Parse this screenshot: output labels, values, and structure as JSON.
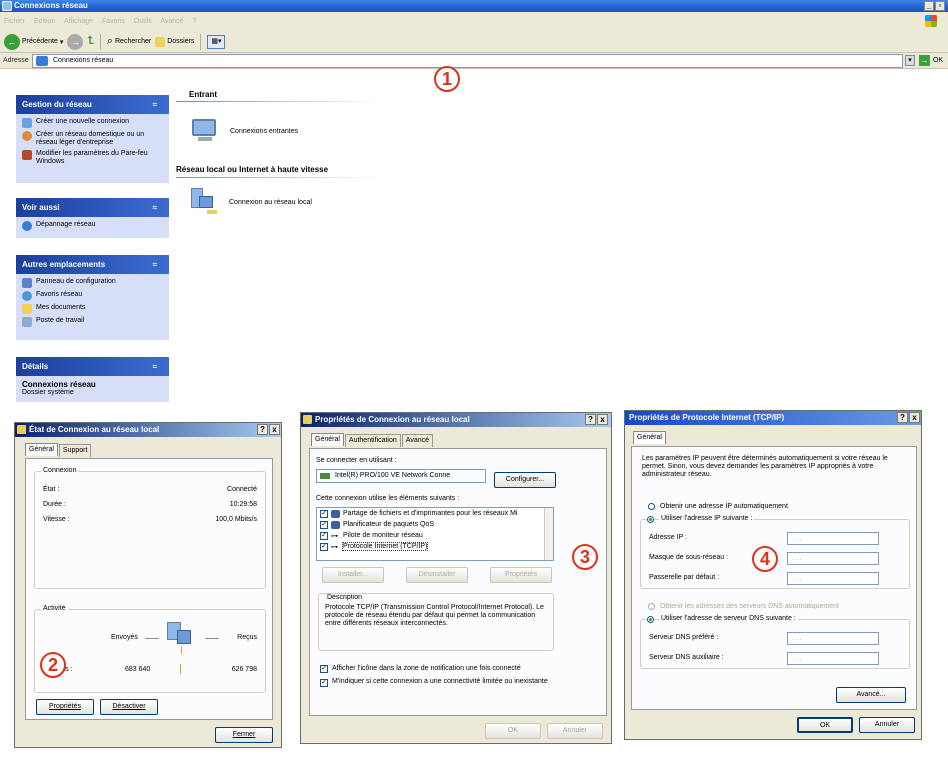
{
  "explorer": {
    "title": "Connexions réseau",
    "menu": [
      "Fichier",
      "Edition",
      "Affichage",
      "Favoris",
      "Outils",
      "Avancé",
      "?"
    ],
    "toolbar": {
      "back": "Précédente",
      "search": "Rechercher",
      "folders": "Dossiers"
    },
    "address_label": "Adresse",
    "address_value": "Connexions réseau",
    "go_label": "OK"
  },
  "callouts": [
    "1",
    "2",
    "3",
    "4"
  ],
  "task_panes": {
    "gestion": {
      "title": "Gestion du réseau",
      "items": [
        "Créer une nouvelle connexion",
        "Créer un réseau domestique ou un réseau léger d'entreprise",
        "Modifier les paramètres du Pare-feu Windows"
      ]
    },
    "voir": {
      "title": "Voir aussi",
      "items": [
        "Dépannage réseau"
      ]
    },
    "autres": {
      "title": "Autres emplacements",
      "items": [
        "Panneau de configuration",
        "Favoris réseau",
        "Mes documents",
        "Poste de travail"
      ]
    },
    "details": {
      "title": "Détails",
      "name": "Connexions réseau",
      "type": "Dossier système"
    }
  },
  "main": {
    "group1": "Entrant",
    "item1": "Connexions entrantes",
    "group2": "Réseau local ou Internet à haute vitesse",
    "item2": "Connexion au réseau local"
  },
  "status_dialog": {
    "title": "État de Connexion au réseau local",
    "tabs": [
      "Général",
      "Support"
    ],
    "connexion_group": "Connexion",
    "rows": [
      {
        "label": "État :",
        "value": "Connecté"
      },
      {
        "label": "Durée :",
        "value": "10:29:58"
      },
      {
        "label": "Vitesse :",
        "value": "100,0 Mbits/s"
      }
    ],
    "activite_group": "Activité",
    "sent_label": "Envoyés",
    "received_label": "Reçus",
    "packets_label": "Paquets :",
    "packets_sent": "683 640",
    "packets_received": "626 798",
    "btn_properties": "Propriétés",
    "btn_disable": "Désactiver",
    "btn_close": "Fermer"
  },
  "props_dialog": {
    "title": "Propriétés de Connexion au réseau local",
    "tabs": [
      "Général",
      "Authentification",
      "Avancé"
    ],
    "connect_using_label": "Se connecter en utilisant :",
    "adapter": "Intel(R) PRO/100 VE Network Conne",
    "btn_configure": "Configurer...",
    "items_label": "Cette connexion utilise les éléments suivants :",
    "items": [
      "Partage de fichiers et d'imprimantes pour les réseaux Mi",
      "Planificateur de paquets QoS",
      "Pilote de moniteur réseau",
      "Protocole Internet (TCP/IP)"
    ],
    "btn_install": "Installer...",
    "btn_uninstall": "Désinstaller",
    "btn_props": "Propriétés",
    "desc_group": "Description",
    "desc_text": "Protocole TCP/IP (Transmission Control Protocol/Internet Protocol). Le protocole de réseau étendu par défaut qui permet la communication entre différents réseaux interconnectés.",
    "chk1": "Afficher l'icône dans la zone de notification une fois connecté",
    "chk2": "M'indiquer si cette connexion a une connectivité limitée ou inexistante",
    "btn_ok": "OK",
    "btn_cancel": "Annuler"
  },
  "tcpip_dialog": {
    "title": "Propriétés de Protocole Internet (TCP/IP)",
    "tabs": [
      "Général"
    ],
    "intro": "Les paramètres IP peuvent être déterminés automatiquement si votre réseau le permet. Sinon, vous devez demander les paramètres IP appropriés à votre administrateur réseau.",
    "radio_auto_ip": "Obtenir une adresse IP automatiquement",
    "radio_manual_ip": "Utiliser l'adresse IP suivante :",
    "ip_label": "Adresse IP :",
    "mask_label": "Masque de sous-réseau :",
    "gateway_label": "Passerelle par défaut :",
    "radio_auto_dns": "Obtenir les adresses des serveurs DNS automatiquement",
    "radio_manual_dns": "Utiliser l'adresse de serveur DNS suivante :",
    "dns1_label": "Serveur DNS préféré :",
    "dns2_label": "Serveur DNS auxiliaire :",
    "ip_placeholder": ".    .    .",
    "btn_advanced": "Avancé...",
    "btn_ok": "OK",
    "btn_cancel": "Annuler"
  }
}
